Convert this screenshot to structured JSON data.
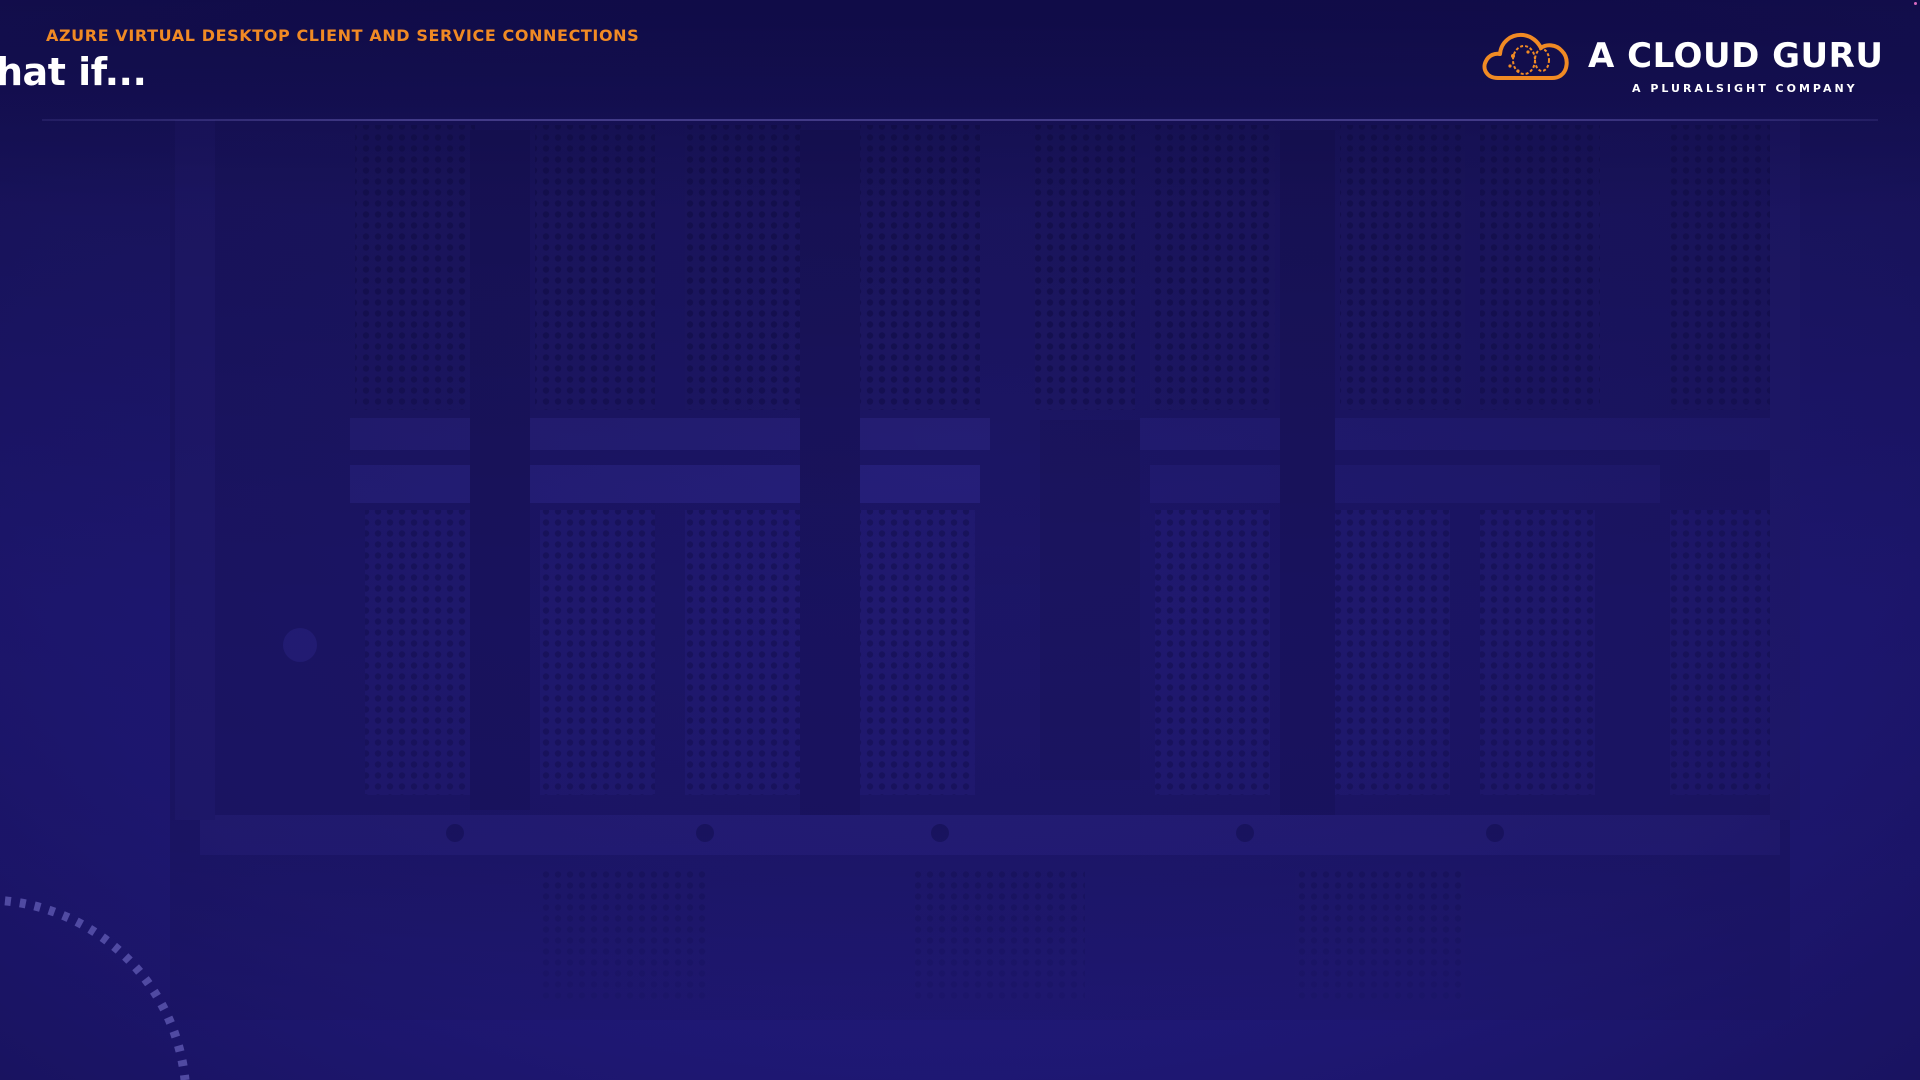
{
  "header": {
    "section_label": "AZURE VIRTUAL DESKTOP CLIENT AND SERVICE CONNECTIONS",
    "title": "hat if..."
  },
  "logo": {
    "name": "A CLOUD GURU",
    "tagline": "A PLURALSIGHT COMPANY",
    "icon": "cloud-icon"
  },
  "colors": {
    "accent": "#f08a24",
    "background": "#1d1660",
    "text": "#ffffff"
  }
}
